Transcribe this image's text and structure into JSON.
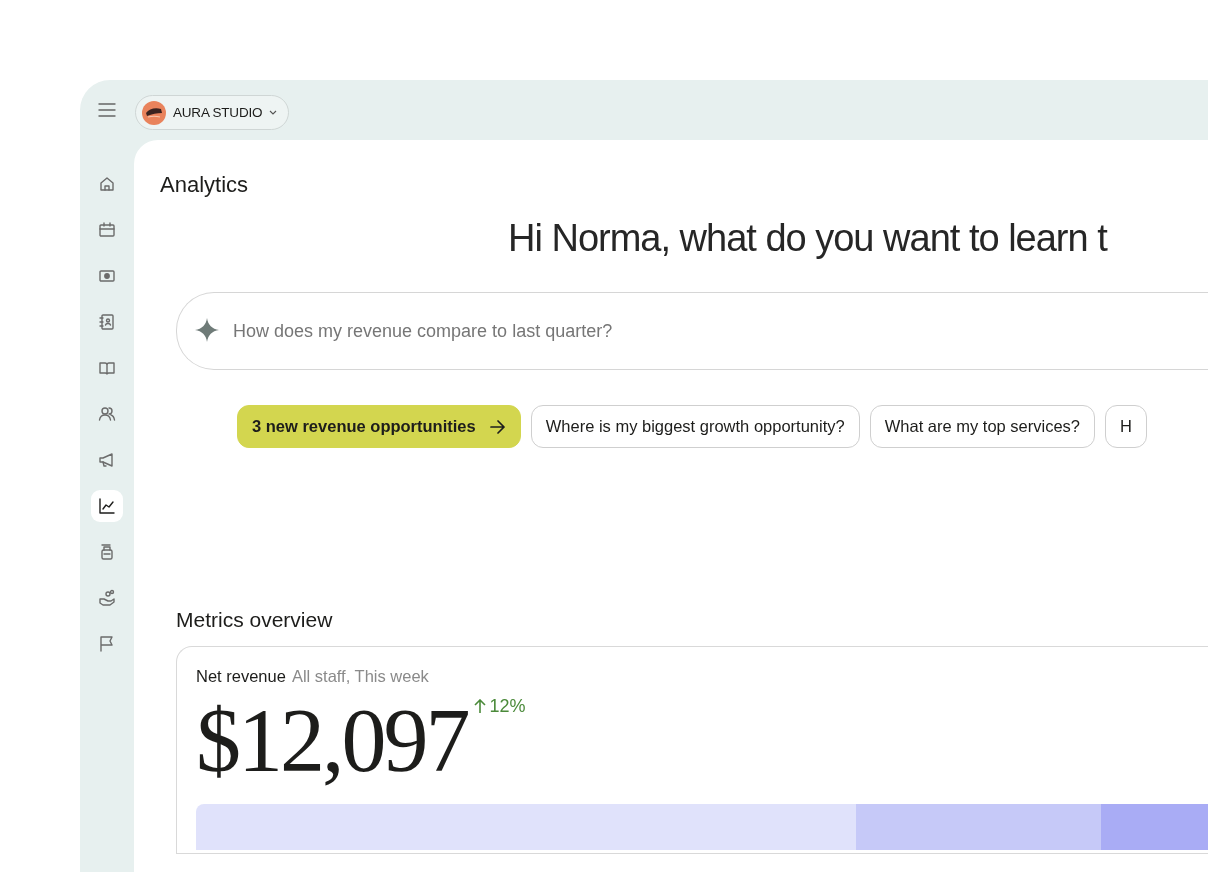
{
  "workspace": {
    "name": "AURA STUDIO"
  },
  "sidebar": {
    "items": [
      {
        "selected": false
      },
      {
        "selected": false
      },
      {
        "selected": false
      },
      {
        "selected": false
      },
      {
        "selected": false
      },
      {
        "selected": false
      },
      {
        "selected": false
      },
      {
        "selected": true
      },
      {
        "selected": false
      },
      {
        "selected": false
      },
      {
        "selected": false
      }
    ]
  },
  "page": {
    "title": "Analytics",
    "greeting": "Hi Norma, what do you want to learn t"
  },
  "search": {
    "placeholder": "How does my revenue compare to last quarter?"
  },
  "suggestions": [
    {
      "label": "3 new revenue opportunities",
      "kind": "highlight"
    },
    {
      "label": "Where is my biggest growth opportunity?",
      "kind": "question"
    },
    {
      "label": "What are my top services?",
      "kind": "question"
    },
    {
      "label": "H",
      "kind": "question"
    }
  ],
  "metrics": {
    "title": "Metrics overview",
    "card": {
      "label": "Net revenue",
      "filter": "All staff, This week",
      "value": "$12,097",
      "change": {
        "text": "12%",
        "increase": true
      }
    }
  }
}
